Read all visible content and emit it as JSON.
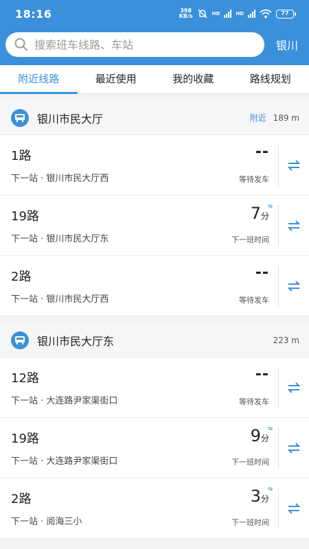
{
  "status": {
    "time": "18:16",
    "speed": "398",
    "speed_unit": "KB/s",
    "hd1": "HD",
    "hd2": "HD",
    "battery": "77"
  },
  "search": {
    "placeholder": "搜索班车线路、车站",
    "city": "银川"
  },
  "tabs": [
    "附近线路",
    "最近使用",
    "我的收藏",
    "路线规划"
  ],
  "groups": [
    {
      "name": "银川市民大厅",
      "near_label": "附近",
      "distance": "189 m",
      "routes": [
        {
          "line": "1路",
          "next": "下一站 · 银川市民大厅西",
          "eta": "--",
          "unit": "",
          "sub": "等待发车"
        },
        {
          "line": "19路",
          "next": "下一站 · 银川市民大厅东",
          "eta": "7",
          "unit": "分",
          "sub": "下一班时间"
        },
        {
          "line": "2路",
          "next": "下一站 · 银川市民大厅西",
          "eta": "--",
          "unit": "",
          "sub": "等待发车"
        }
      ]
    },
    {
      "name": "银川市民大厅东",
      "near_label": "",
      "distance": "223 m",
      "routes": [
        {
          "line": "12路",
          "next": "下一站 · 大连路尹家渠街口",
          "eta": "--",
          "unit": "",
          "sub": "等待发车"
        },
        {
          "line": "19路",
          "next": "下一站 · 大连路尹家渠街口",
          "eta": "9",
          "unit": "分",
          "sub": "下一班时间"
        },
        {
          "line": "2路",
          "next": "下一站 · 阅海三小",
          "eta": "3",
          "unit": "分",
          "sub": "下一班时间"
        }
      ]
    }
  ],
  "colors": {
    "accent": "#3b90dc"
  },
  "icons": {
    "search": "search-icon",
    "stop": "bus-stop-icon",
    "swap": "swap-direction-icon",
    "live": "live-signal-icon"
  }
}
